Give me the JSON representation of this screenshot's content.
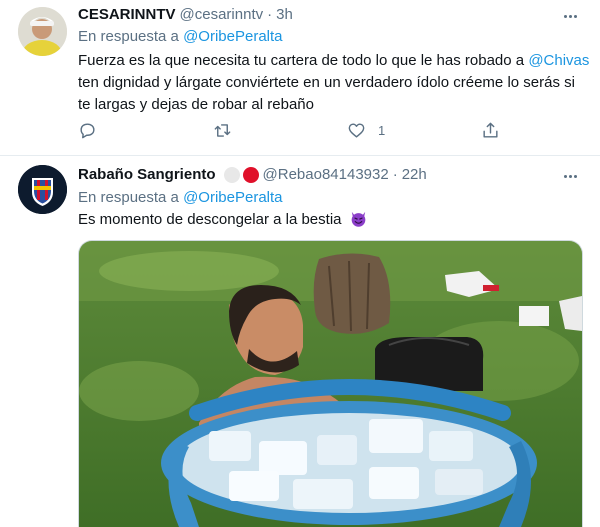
{
  "tweets": [
    {
      "name": "CESARINNTV",
      "handle": "@cesarinntv",
      "separator": "·",
      "time": "3h",
      "reply_prefix": "En respuesta a",
      "reply_to": "@OribePeralta",
      "text_line1_a": "Fuerza es la que necesita tu cartera de todo lo que le has robado a",
      "text_line1_mention": "@Chivas",
      "text_line2": "ten dignidad y lárgate conviértete en un verdadero ídolo créeme lo serás si",
      "text_line3": "te largas y dejas de robar al rebaño",
      "like_count": "1"
    },
    {
      "name": "Rabaño Sangriento",
      "handle": "@Rebao84143932",
      "separator": "·",
      "time": "22h",
      "reply_prefix": "En respuesta a",
      "reply_to": "@OribePeralta",
      "text": "Es momento de descongelar a la bestia"
    }
  ],
  "icons": {
    "more": "more-horizontal-icon",
    "reply": "reply-bubble-icon",
    "retweet": "retweet-icon",
    "like": "heart-icon",
    "share": "share-icon",
    "emoji": "smiling-devil-emoji",
    "badges": [
      "white-circle",
      "red-circle"
    ]
  },
  "colors": {
    "link": "#1b95e0",
    "secondary": "#5b7083",
    "text": "#0f1419",
    "devil_emoji": "#8b3ec9",
    "red_badge": "#e0102a"
  }
}
